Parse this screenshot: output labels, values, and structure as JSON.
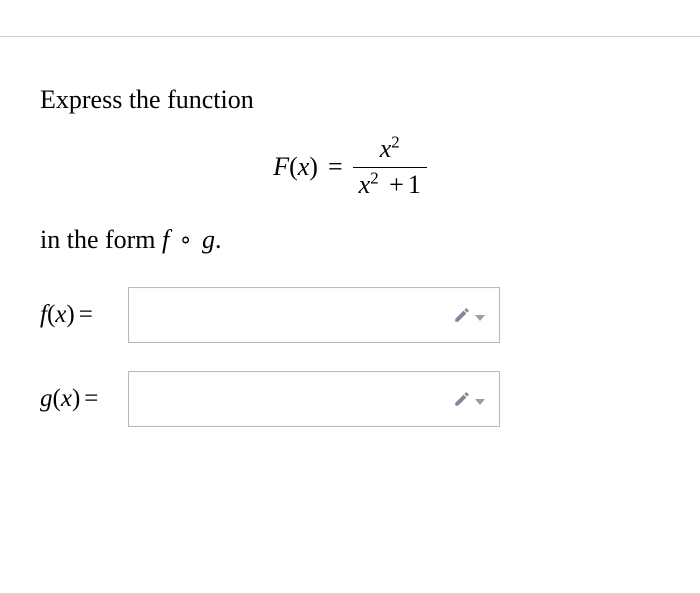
{
  "prompt": {
    "line1": "Express the function",
    "line2_prefix": "in the form ",
    "compose_f": "f",
    "compose_op": "∘",
    "compose_g": "g",
    "period": "."
  },
  "equation": {
    "lhs_fn": "F",
    "lhs_var": "x",
    "eq": "=",
    "numerator_var": "x",
    "numerator_exp": "2",
    "denom_var": "x",
    "denom_exp": "2",
    "denom_plus": "+",
    "denom_const": "1"
  },
  "inputs": {
    "f": {
      "fn": "f",
      "var": "x",
      "eq": "=",
      "value": ""
    },
    "g": {
      "fn": "g",
      "var": "x",
      "eq": "=",
      "value": ""
    }
  }
}
